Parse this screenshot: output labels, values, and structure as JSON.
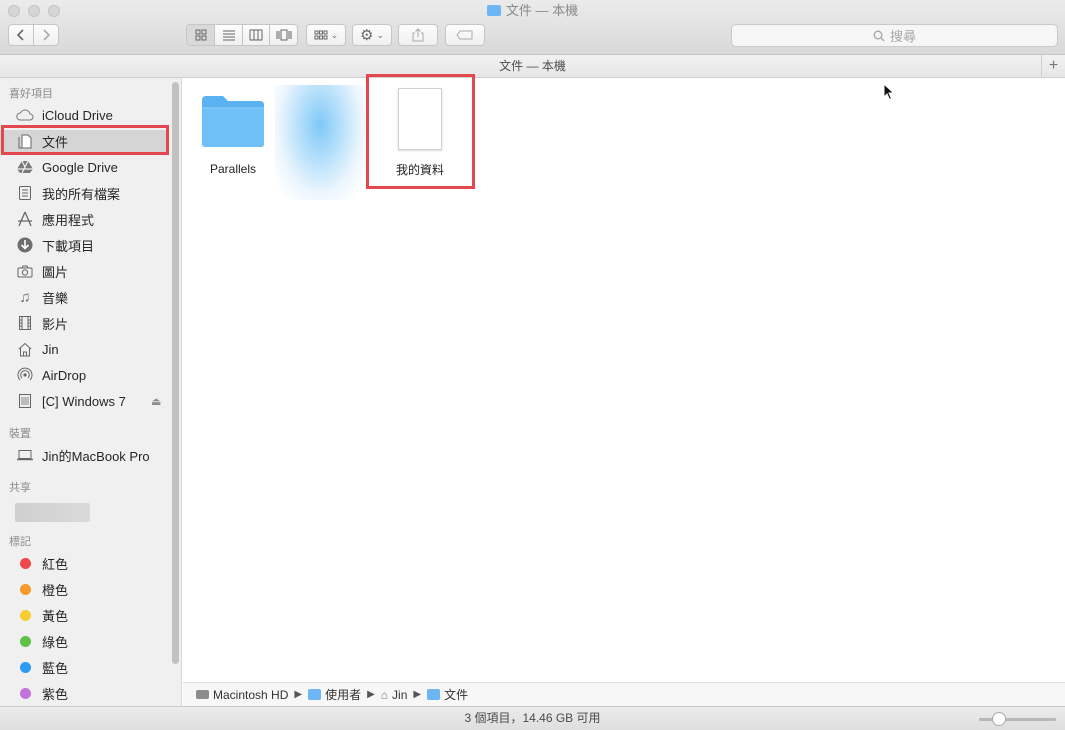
{
  "window": {
    "title": "文件 — 本機",
    "header_title": "文件 — 本機"
  },
  "toolbar": {
    "back_icon": "chevron-left-icon",
    "forward_icon": "chevron-right-icon",
    "view_modes": [
      "icon-view",
      "list-view",
      "column-view",
      "cover-flow-view"
    ],
    "arrange_icon": "arrange-grid-icon",
    "action_icon": "gear-icon",
    "share_icon": "share-icon",
    "tags_icon": "tag-icon",
    "search_placeholder": "搜尋",
    "add_tab": "+"
  },
  "sidebar": {
    "favorites_header": "喜好項目",
    "favorites": [
      {
        "label": "iCloud Drive",
        "icon": "cloud-icon"
      },
      {
        "label": "文件",
        "icon": "documents-icon",
        "selected": true
      },
      {
        "label": "Google Drive",
        "icon": "google-drive-icon"
      },
      {
        "label": "我的所有檔案",
        "icon": "all-files-icon"
      },
      {
        "label": "應用程式",
        "icon": "applications-icon"
      },
      {
        "label": "下載項目",
        "icon": "download-icon"
      },
      {
        "label": "圖片",
        "icon": "camera-icon"
      },
      {
        "label": "音樂",
        "icon": "music-note-icon"
      },
      {
        "label": "影片",
        "icon": "film-icon"
      },
      {
        "label": "Jin",
        "icon": "home-icon"
      },
      {
        "label": "AirDrop",
        "icon": "airdrop-icon"
      },
      {
        "label": "[C] Windows 7",
        "icon": "disk-icon",
        "eject": true
      }
    ],
    "devices_header": "裝置",
    "devices": [
      {
        "label": "Jin的MacBook Pro",
        "icon": "laptop-icon"
      }
    ],
    "shared_header": "共享",
    "tags_header": "標記",
    "tags": [
      {
        "label": "紅色",
        "color": "#f0484a"
      },
      {
        "label": "橙色",
        "color": "#f79a2b"
      },
      {
        "label": "黃色",
        "color": "#f6cc31"
      },
      {
        "label": "綠色",
        "color": "#5fc146"
      },
      {
        "label": "藍色",
        "color": "#2e9df1"
      },
      {
        "label": "紫色",
        "color": "#c373d9"
      }
    ]
  },
  "files": [
    {
      "name": "Parallels",
      "kind": "folder"
    },
    {
      "name": "",
      "kind": "blurred"
    },
    {
      "name": "我的資料",
      "kind": "document"
    }
  ],
  "breadcrumb": [
    {
      "label": "Macintosh HD",
      "icon": "hard-drive-icon"
    },
    {
      "label": "使用者",
      "icon": "users-folder-icon"
    },
    {
      "label": "Jin",
      "icon": "home-icon"
    },
    {
      "label": "文件",
      "icon": "documents-folder-icon"
    }
  ],
  "status": {
    "text": "3 個項目，14.46 GB 可用",
    "icon_size_level": 0.25
  },
  "colors": {
    "highlight_box": "#e4474d",
    "folder_blue": "#6cb6f3"
  }
}
